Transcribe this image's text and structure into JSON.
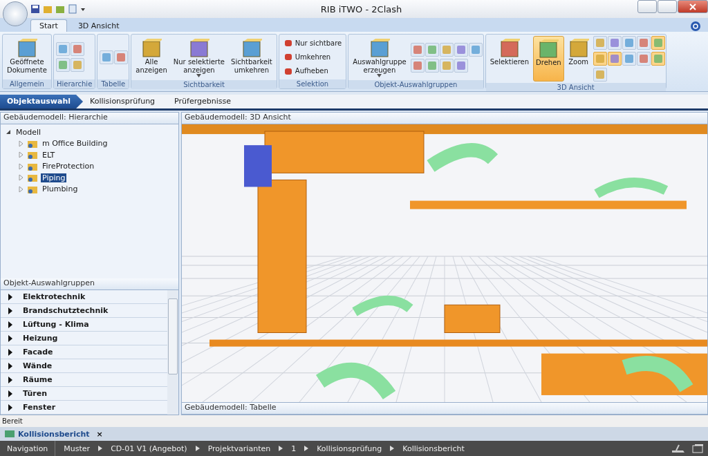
{
  "window": {
    "title": "RIB iTWO - 2Clash"
  },
  "ribbon_tabs": [
    {
      "label": "Start",
      "selected": true
    },
    {
      "label": "3D Ansicht",
      "selected": false
    }
  ],
  "ribbon_groups": [
    {
      "label": "Allgemein",
      "buttons": [
        {
          "kind": "large",
          "label": "Geöffnete\nDokumente",
          "selected": false,
          "dropdown": false
        }
      ]
    },
    {
      "label": "Hierarchie",
      "buttons": [
        {
          "kind": "icon",
          "selected": false
        },
        {
          "kind": "icon",
          "selected": false
        },
        {
          "kind": "icon",
          "selected": false
        },
        {
          "kind": "icon",
          "selected": false
        }
      ]
    },
    {
      "label": "Tabelle",
      "buttons": [
        {
          "kind": "icon",
          "selected": false
        },
        {
          "kind": "icon",
          "selected": false
        }
      ]
    },
    {
      "label": "Sichtbarkeit",
      "buttons": [
        {
          "kind": "large",
          "label": "Alle\nanzeigen",
          "selected": false,
          "dropdown": false
        },
        {
          "kind": "large",
          "label": "Nur selektierte\nanzeigen",
          "selected": false,
          "dropdown": true
        },
        {
          "kind": "large",
          "label": "Sichtbarkeit\numkehren",
          "selected": false,
          "dropdown": false
        }
      ]
    },
    {
      "label": "Selektion",
      "buttons": [
        {
          "kind": "small",
          "label": "Nur sichtbare",
          "selected": false
        },
        {
          "kind": "small",
          "label": "Umkehren",
          "selected": false
        },
        {
          "kind": "small",
          "label": "Aufheben",
          "selected": false
        }
      ]
    },
    {
      "label": "Objekt-Auswahlgruppen",
      "buttons": [
        {
          "kind": "large",
          "label": "Auswahlgruppe\nerzeugen",
          "selected": false,
          "dropdown": true
        },
        {
          "kind": "icon",
          "selected": false
        },
        {
          "kind": "icon",
          "selected": false
        },
        {
          "kind": "icon",
          "selected": false
        },
        {
          "kind": "icon",
          "selected": false
        },
        {
          "kind": "icon",
          "selected": false
        },
        {
          "kind": "icon",
          "selected": false
        },
        {
          "kind": "icon",
          "selected": false
        },
        {
          "kind": "icon",
          "selected": false
        },
        {
          "kind": "icon",
          "selected": false
        }
      ]
    },
    {
      "label": "3D Ansicht",
      "buttons": [
        {
          "kind": "large",
          "label": "Selektieren",
          "selected": false,
          "dropdown": false
        },
        {
          "kind": "large",
          "label": "Drehen",
          "selected": true,
          "dropdown": false
        },
        {
          "kind": "large",
          "label": "Zoom",
          "selected": false,
          "dropdown": false
        },
        {
          "kind": "icon",
          "selected": false
        },
        {
          "kind": "icon",
          "selected": false
        },
        {
          "kind": "icon",
          "selected": false
        },
        {
          "kind": "icon",
          "selected": false
        },
        {
          "kind": "icon",
          "selected": true
        },
        {
          "kind": "icon",
          "selected": true
        },
        {
          "kind": "icon",
          "selected": true
        },
        {
          "kind": "icon",
          "selected": false
        },
        {
          "kind": "icon",
          "selected": false
        },
        {
          "kind": "icon",
          "selected": true
        },
        {
          "kind": "icon",
          "selected": false
        }
      ]
    }
  ],
  "steps": [
    {
      "label": "Objektauswahl",
      "selected": true
    },
    {
      "label": "Kollisionsprüfung",
      "selected": false
    },
    {
      "label": "Prüfergebnisse",
      "selected": false
    }
  ],
  "hierarchy": {
    "title": "Gebäudemodell: Hierarchie",
    "tree": [
      {
        "label": "Modell",
        "expanded": true,
        "selected": false,
        "children": [
          {
            "label": "m Office Building",
            "expanded": false,
            "selected": false
          },
          {
            "label": "ELT",
            "expanded": false,
            "selected": false
          },
          {
            "label": "FireProtection",
            "expanded": false,
            "selected": false
          },
          {
            "label": "Piping",
            "expanded": false,
            "selected": true
          },
          {
            "label": "Plumbing",
            "expanded": false,
            "selected": false
          }
        ]
      }
    ]
  },
  "groups_panel": {
    "title": "Objekt-Auswahlgruppen",
    "items": [
      "Elektrotechnik",
      "Brandschutztechnik",
      "Lüftung - Klima",
      "Heizung",
      "Facade",
      "Wände",
      "Räume",
      "Türen",
      "Fenster"
    ]
  },
  "viewport": {
    "title": "Gebäudemodell: 3D Ansicht"
  },
  "table_panel": {
    "title": "Gebäudemodell: Tabelle"
  },
  "status": "Bereit",
  "doc_tabs": [
    {
      "label": "Kollisionsbericht",
      "close": "×"
    }
  ],
  "breadcrumb": [
    "Navigation",
    "Muster",
    "CD-01 V1 (Angebot)",
    "Projektvarianten",
    "1",
    "Kollisionsprüfung",
    "Kollisionsbericht"
  ]
}
